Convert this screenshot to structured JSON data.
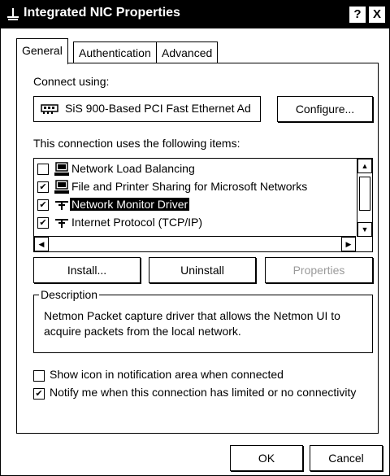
{
  "window": {
    "title": "Integrated NIC Properties",
    "help_label": "?",
    "close_label": "X"
  },
  "tabs": [
    {
      "label": "General",
      "active": true
    },
    {
      "label": "Authentication",
      "active": false
    },
    {
      "label": "Advanced",
      "active": false
    }
  ],
  "general": {
    "connect_using_label": "Connect using:",
    "adapter_name": "SiS 900-Based PCI Fast Ethernet Ad",
    "configure_button": "Configure...",
    "items_label": "This connection uses the following items:",
    "items": [
      {
        "label": "Network Load Balancing",
        "checked": false,
        "icon": "computer-icon",
        "selected": false
      },
      {
        "label": "File and Printer Sharing for Microsoft Networks",
        "checked": true,
        "icon": "computer-icon",
        "selected": false
      },
      {
        "label": "Network Monitor Driver",
        "checked": true,
        "icon": "protocol-icon",
        "selected": true
      },
      {
        "label": "Internet Protocol (TCP/IP)",
        "checked": true,
        "icon": "protocol-icon",
        "selected": false
      }
    ],
    "install_button": "Install...",
    "uninstall_button": "Uninstall",
    "properties_button": "Properties",
    "properties_enabled": false,
    "description_legend": "Description",
    "description_text": "Netmon Packet capture driver that allows the Netmon UI to acquire packets from the local network.",
    "show_icon_label": "Show icon in notification area when connected",
    "show_icon_checked": false,
    "notify_label": "Notify me when this connection has limited or no connectivity",
    "notify_checked": true
  },
  "footer": {
    "ok_button": "OK",
    "cancel_button": "Cancel"
  }
}
